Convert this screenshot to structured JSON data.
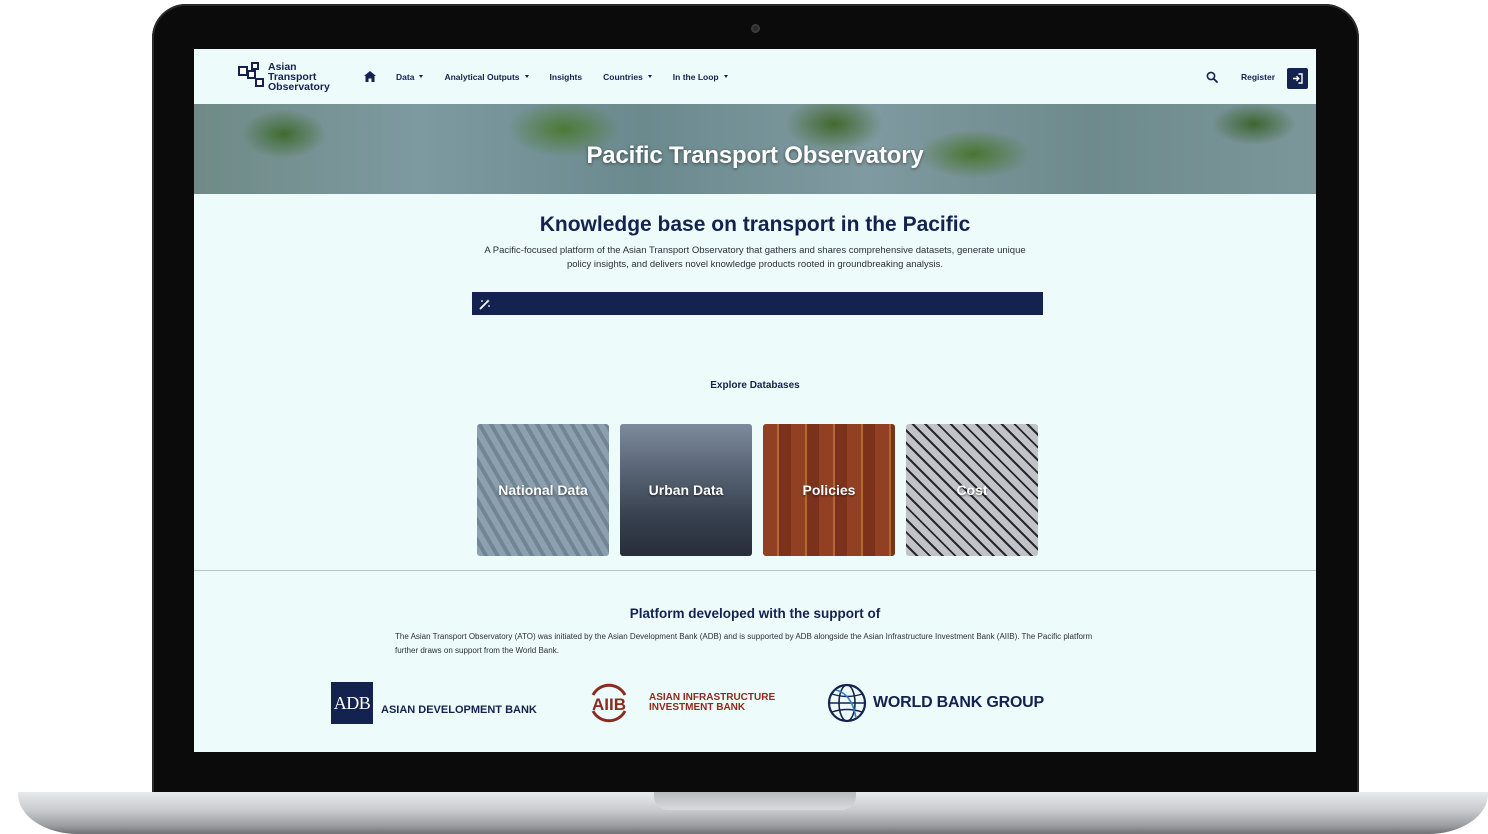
{
  "brand": {
    "logo_text": [
      "Asian",
      "Transport",
      "Observatory"
    ]
  },
  "nav": {
    "items": [
      {
        "label": "Data",
        "has_dropdown": true
      },
      {
        "label": "Analytical Outputs",
        "has_dropdown": true
      },
      {
        "label": "Insights",
        "has_dropdown": false
      },
      {
        "label": "Countries",
        "has_dropdown": true
      },
      {
        "label": "In the Loop",
        "has_dropdown": true
      }
    ],
    "register_label": "Register",
    "home_icon": "home-icon",
    "search_icon": "search-icon",
    "login_icon": "sign-in-icon"
  },
  "hero": {
    "title": "Pacific Transport Observatory"
  },
  "intro": {
    "title": "Knowledge base on transport in the Pacific",
    "text": "A Pacific-focused platform of the Asian Transport Observatory that gathers and shares comprehensive datasets, generate unique policy insights, and delivers novel knowledge products rooted in groundbreaking analysis.",
    "search_icon": "magic-wand-icon"
  },
  "databases": {
    "heading": "Explore Databases",
    "cards": [
      {
        "label": "National Data"
      },
      {
        "label": "Urban Data"
      },
      {
        "label": "Policies"
      },
      {
        "label": "Cost"
      }
    ]
  },
  "support": {
    "heading": "Platform developed with the support of",
    "text": "The Asian Transport Observatory (ATO) was initiated by the Asian Development Bank (ADB) and is supported by ADB alongside the Asian Infrastructure Investment Bank (AIIB). The Pacific platform further draws on support from the World Bank.",
    "partners": {
      "adb_mark": "ADB",
      "adb_name": "ASIAN DEVELOPMENT BANK",
      "aiib_mark": "AIIB",
      "aiib_name_line1": "ASIAN INFRASTRUCTURE",
      "aiib_name_line2": "INVESTMENT BANK",
      "wb_name": "WORLD BANK GROUP"
    }
  },
  "colors": {
    "navy": "#14224f",
    "background": "#eefbfb",
    "aiib_red": "#8d2a1e"
  }
}
